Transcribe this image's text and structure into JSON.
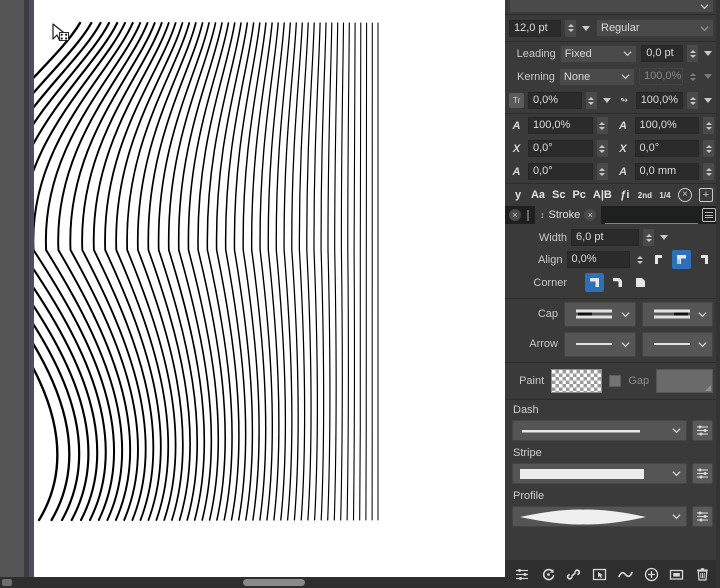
{
  "app": {
    "theme_bg": "#3a3a3a",
    "accent": "#2d6fb8",
    "canvas_bg": "#555555",
    "page_bg": "#ffffff"
  },
  "canvas": {
    "name": "document-canvas",
    "artwork_description": "black flowing curved vector lines",
    "cursor": "selection-arrow-with-badge"
  },
  "text_panel": {
    "font_size": {
      "label": "",
      "value": "12,0 pt"
    },
    "font_style": {
      "value": "Regular"
    },
    "leading": {
      "label": "Leading",
      "mode": "Fixed",
      "value": "0,0 pt"
    },
    "kerning": {
      "label": "Kerning",
      "mode": "None",
      "value": "100,0%"
    },
    "tracking": {
      "icon": "tracking-icon",
      "value": "0,0%"
    },
    "horizontal_scale2": {
      "icon": "baseline-icon",
      "value": "100,0%"
    },
    "scale_h": {
      "icon": "A",
      "value": "100,0%"
    },
    "scale_v": {
      "icon": "A",
      "value": "100,0%"
    },
    "skew_x": {
      "icon": "X",
      "value": "0,0°"
    },
    "skew_y": {
      "icon": "X",
      "value": "0,0°"
    },
    "rotate": {
      "icon": "A",
      "value": "0,0°"
    },
    "baseline": {
      "icon": "A",
      "value": "0,0 mm"
    },
    "typo_glyphs": [
      "y",
      "Aa",
      "Sc",
      "Pc",
      "A|B",
      "ƒi",
      "2nd",
      "1/4"
    ],
    "typo_clear": "×",
    "typo_add": "+"
  },
  "tabbar": {
    "close_left": "×",
    "active_tab": "Stroke",
    "active_tab_close": "×",
    "menu_icon": "hamburger-menu-icon"
  },
  "stroke_panel": {
    "width": {
      "label": "Width",
      "value": "6,0 pt"
    },
    "align": {
      "label": "Align",
      "value": "0,0%",
      "buttons": [
        "align-inside",
        "align-center",
        "align-outside"
      ],
      "selected": 1
    },
    "corner": {
      "label": "Corner",
      "buttons": [
        "corner-miter",
        "corner-round",
        "corner-bevel"
      ],
      "selected": 0
    },
    "cap": {
      "label": "Cap",
      "start": "cap-butt",
      "end": "cap-butt"
    },
    "arrow": {
      "label": "Arrow",
      "start": "arrow-none",
      "end": "arrow-none"
    },
    "paint": {
      "label": "Paint",
      "swatch": "transparent-checker"
    },
    "gap": {
      "label": "Gap",
      "checked": false,
      "swatch": "gray"
    },
    "dash": {
      "label": "Dash",
      "preview": "solid-line",
      "settings_icon": "sliders-icon"
    },
    "stripe": {
      "label": "Stripe",
      "preview": "solid-bar",
      "settings_icon": "sliders-icon"
    },
    "profile": {
      "label": "Profile",
      "preview": "lens-profile",
      "settings_icon": "sliders-icon"
    }
  },
  "bottom_bar": {
    "icons": [
      "sliders-icon",
      "refresh-icon",
      "link-icon",
      "select-box-icon",
      "wave-icon",
      "add-circle-icon",
      "rectangle-icon",
      "trash-icon"
    ]
  }
}
